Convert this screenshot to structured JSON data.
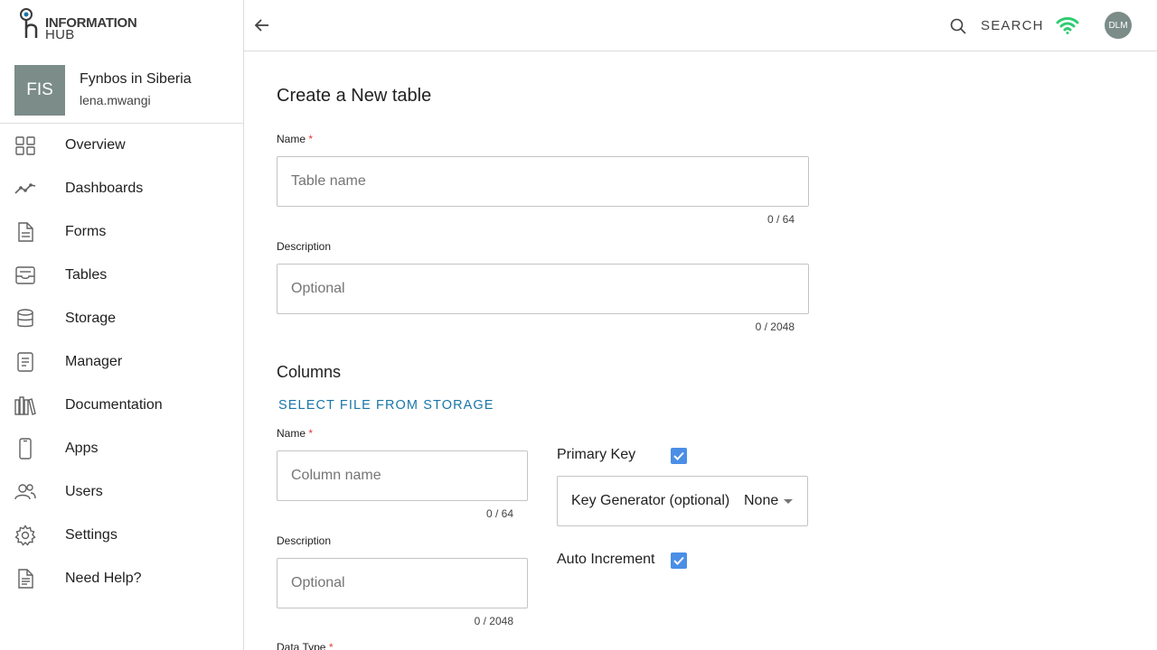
{
  "logo": {
    "line1": "INFORMATION",
    "line2": "HUB"
  },
  "account": {
    "initials": "FIS",
    "name": "Fynbos in Siberia",
    "username": "lena.mwangi"
  },
  "sidebar": {
    "items": [
      {
        "label": "Overview",
        "icon": "grid-icon"
      },
      {
        "label": "Dashboards",
        "icon": "trend-line-icon"
      },
      {
        "label": "Forms",
        "icon": "document-icon"
      },
      {
        "label": "Tables",
        "icon": "inbox-tray-icon"
      },
      {
        "label": "Storage",
        "icon": "database-icon"
      },
      {
        "label": "Manager",
        "icon": "clipboard-icon"
      },
      {
        "label": "Documentation",
        "icon": "books-icon"
      },
      {
        "label": "Apps",
        "icon": "smartphone-icon"
      },
      {
        "label": "Users",
        "icon": "users-icon"
      },
      {
        "label": "Settings",
        "icon": "gear-icon"
      },
      {
        "label": "Need Help?",
        "icon": "help-document-icon"
      }
    ]
  },
  "topbar": {
    "search_label": "SEARCH",
    "user_initials": "DLM",
    "wifi_color": "#2ecc71"
  },
  "form": {
    "title": "Create a New table",
    "name_label": "Name",
    "name_placeholder": "Table name",
    "name_counter": "0 / 64",
    "description_label": "Description",
    "description_placeholder": "Optional",
    "description_counter": "0 / 2048",
    "required_mark": "*"
  },
  "columns": {
    "title": "Columns",
    "select_file_label": "SELECT FILE FROM STORAGE",
    "name_label": "Name",
    "name_placeholder": "Column name",
    "name_counter": "0 / 64",
    "description_label": "Description",
    "description_placeholder": "Optional",
    "description_counter": "0 / 2048",
    "data_type_label": "Data Type",
    "primary_key_label": "Primary Key",
    "primary_key_checked": true,
    "key_generator_label": "Key Generator (optional)",
    "key_generator_value": "None",
    "auto_increment_label": "Auto Increment",
    "auto_increment_checked": true
  },
  "colors": {
    "accent": "#1976a8",
    "checkbox": "#4a8ee6",
    "avatar": "#7b8c89",
    "required": "#e53935"
  }
}
